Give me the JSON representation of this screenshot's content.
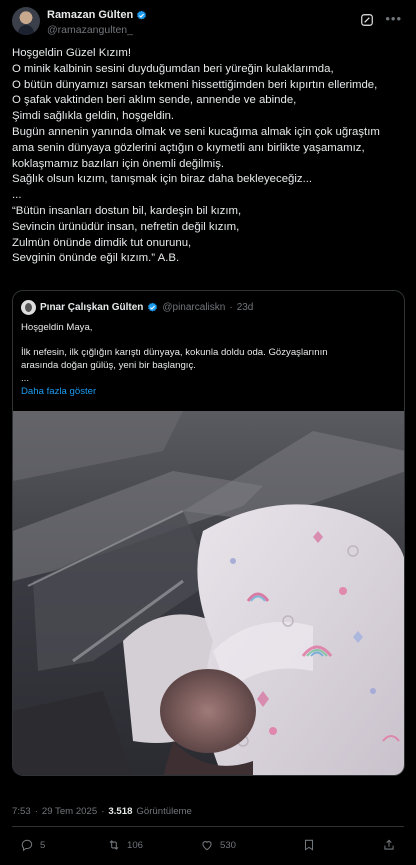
{
  "author": {
    "display_name": "Ramazan Gülten",
    "handle": "@ramazangulten_",
    "verified": true
  },
  "post": {
    "lines": [
      "Hoşgeldin Güzel Kızım!",
      "O minik kalbinin sesini duyduğumdan beri yüreğin kulaklarımda,",
      "O bütün dünyamızı sarsan tekmeni hissettiğimden beri kıpırtın ellerimde,",
      "O şafak vaktinden beri aklım sende, annende ve abinde,",
      "Şimdi sağlıkla geldin, hoşgeldin.",
      "Bugün annenin yanında olmak ve seni kucağıma almak için çok uğraştım",
      "ama senin dünyaya gözlerini açtığın o kıymetli anı birlikte yaşamamız,",
      "koklaşmamız bazıları için önemli değilmiş.",
      "Sağlık olsun kızım, tanışmak için biraz daha bekleyeceğiz...",
      "...",
      "“Bütün insanları dostun bil, kardeşin bil kızım,",
      "Sevincin ürünüdür insan, nefretin değil kızım,",
      "Zulmün önünde dimdik tut onurunu,",
      "Sevginin önünde eğil kızım.” A.B."
    ]
  },
  "quote": {
    "display_name": "Pınar Çalışkan Gülten",
    "handle": "@pinarcaliskn",
    "separator": "·",
    "time": "23d",
    "line1": "Hoşgeldin Maya,",
    "line2": "İlk nefesin, ilk çığlığın karıştı dünyaya, kokunla doldu oda. Gözyaşlarının",
    "line3": "arasında doğan gülüş, yeni bir başlangıç.",
    "ellipsis": "...",
    "show_more": "Daha fazla göster"
  },
  "meta": {
    "time": "7:53",
    "separator": "·",
    "date": "29 Tem 2025",
    "separator2": "·",
    "views": "3.518",
    "views_label": "Görüntüleme"
  },
  "actions": {
    "replies": "5",
    "reposts": "106",
    "likes": "530"
  },
  "colors": {
    "background": "#000000",
    "text": "#e7e9ea",
    "secondary": "#71767b",
    "accent": "#1d9bf0",
    "border": "#2f3336"
  },
  "icons": [
    "verified-badge-icon",
    "grok-icon",
    "more-icon",
    "reply-icon",
    "repost-icon",
    "like-icon",
    "bookmark-icon",
    "share-icon"
  ]
}
